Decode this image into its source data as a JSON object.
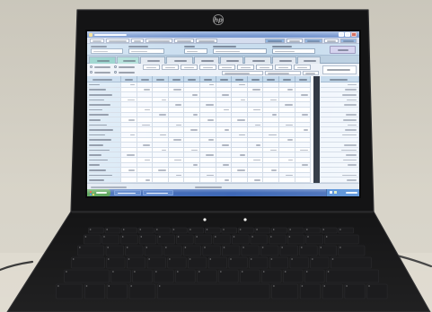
{
  "logo": {
    "text": "hp"
  },
  "icons": {
    "logo": "hp-logo-icon",
    "start_button": "start-flag-icon",
    "window_minimize": "minimize-icon",
    "window_maximize": "maximize-icon",
    "window_close": "close-icon"
  },
  "colors": {
    "wall": "#d5d1c5",
    "table": "#dcd7cb",
    "bezel": "#141415",
    "keyboard_deck": "#101011",
    "key": "#1c1c1e",
    "status_led": "#f1f1ee",
    "screen_background": "#dde5ef",
    "titlebar": "#6a90d2",
    "toolbar": "#ccd6ea",
    "form_panel": "#bed6ea",
    "register_button": "#cbc8ea",
    "tab": "#d9e0ea",
    "tab_active": "#7cc9c1",
    "grid_header": "#b9d2e8",
    "grid_label_cell": "#d0e1f0",
    "grid_cell": "#eef2f7",
    "scroll_bar": "#1e2836",
    "taskbar": "#3363bd",
    "start_button": "#3f9b3d"
  }
}
